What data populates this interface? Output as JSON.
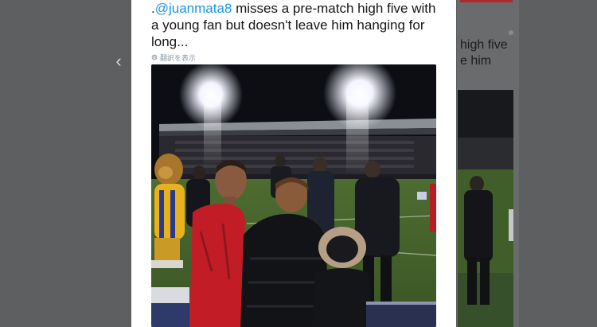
{
  "tweet": {
    "text_prefix": ".",
    "mention": "@juanmata8",
    "text_rest": " misses a pre-match high five with a young fan but doesn't leave him hanging for long...",
    "translate_label": "翻訳を表示"
  },
  "next_tweet_partial": {
    "line1": "high five",
    "line2": "e him"
  },
  "icons": {
    "nav_prev": "chevron-left-icon",
    "translate": "globe-icon"
  },
  "colors": {
    "mention": "#1b95e0",
    "overlay": "#5e5f60",
    "card": "#ffffff"
  }
}
